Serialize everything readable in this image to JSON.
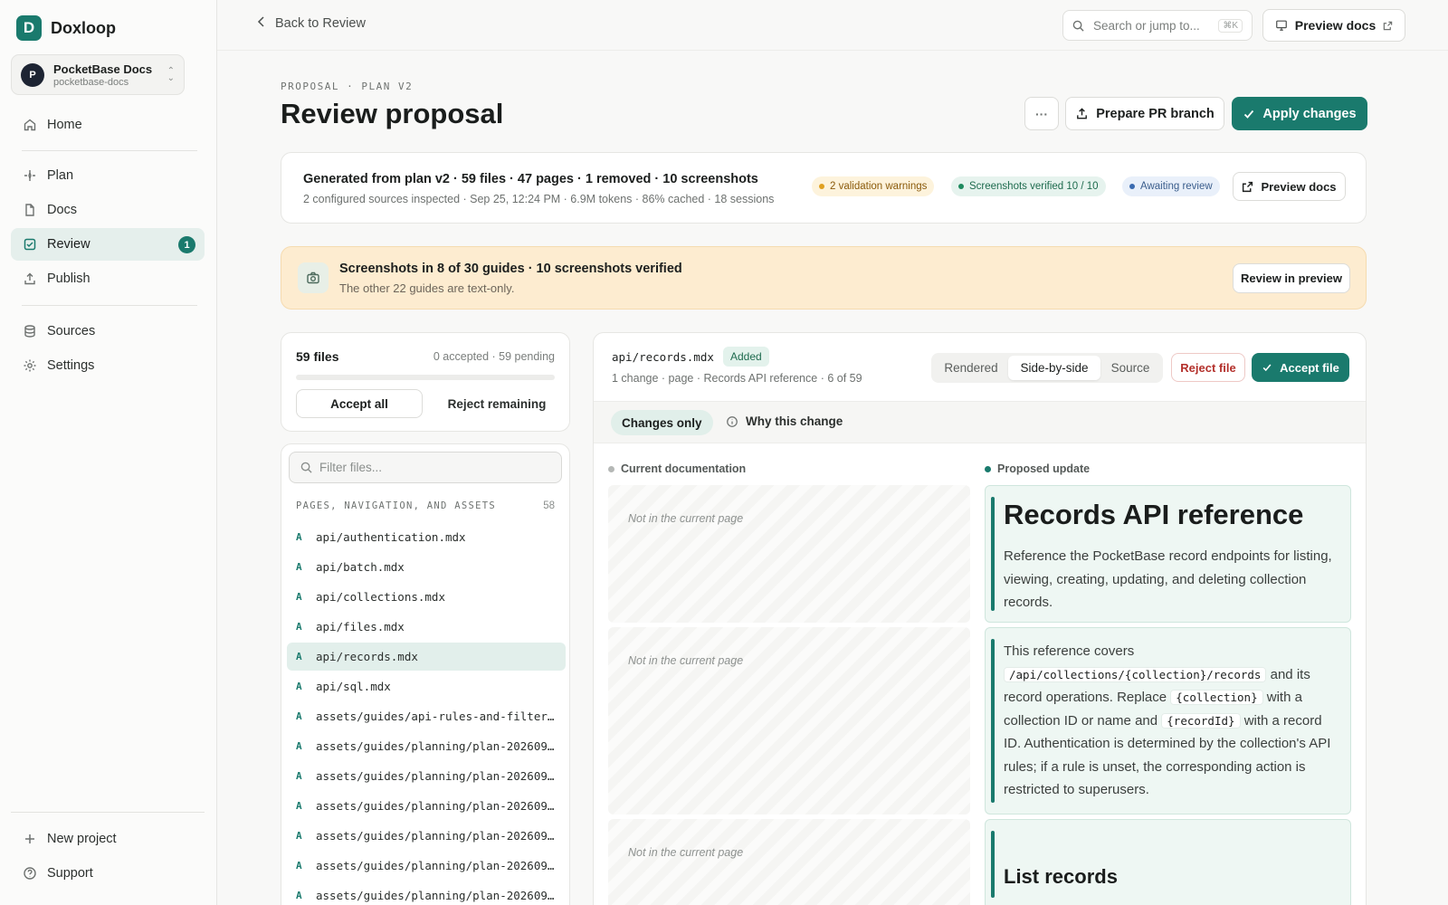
{
  "brand": {
    "logo_letter": "D",
    "name": "Doxloop",
    "accent": "#1a7a6d"
  },
  "project": {
    "avatar": "P",
    "name": "PocketBase Docs",
    "slug": "pocketbase-docs"
  },
  "nav": {
    "home": "Home",
    "plan": "Plan",
    "docs": "Docs",
    "review": "Review",
    "review_badge": "1",
    "publish": "Publish",
    "sources": "Sources",
    "settings": "Settings",
    "new_project": "New project",
    "support": "Support"
  },
  "topbar": {
    "back": "Back to Review",
    "search_placeholder": "Search or jump to...",
    "search_shortcut": "⌘K",
    "preview_docs": "Preview docs"
  },
  "header": {
    "eyebrow": "PROPOSAL · PLAN V2",
    "title": "Review proposal",
    "more": "···",
    "prepare_pr": "Prepare PR branch",
    "apply": "Apply changes"
  },
  "summary": {
    "line1": "Generated from plan v2 · 59 files · 47 pages · 1 removed · 10 screenshots",
    "line2": "2 configured sources inspected · Sep 25, 12:24 PM · 6.9M tokens · 86% cached · 18 sessions",
    "warnings": "2 validation warnings",
    "verified": "Screenshots verified 10 / 10",
    "awaiting": "Awaiting review",
    "preview_docs": "Preview docs"
  },
  "banner": {
    "title": "Screenshots in 8 of 30 guides · 10 screenshots verified",
    "subtitle": "The other 22 guides are text-only.",
    "button": "Review in preview"
  },
  "files": {
    "count": "59 files",
    "status": "0 accepted · 59 pending",
    "accepted_fraction": 0,
    "accept_all": "Accept all",
    "reject_remaining": "Reject remaining",
    "filter_placeholder": "Filter files...",
    "group_label": "PAGES, NAVIGATION, AND ASSETS",
    "group_count": "58",
    "items": [
      {
        "tag": "A",
        "path": "api/authentication.mdx"
      },
      {
        "tag": "A",
        "path": "api/batch.mdx"
      },
      {
        "tag": "A",
        "path": "api/collections.mdx"
      },
      {
        "tag": "A",
        "path": "api/files.mdx"
      },
      {
        "tag": "A",
        "path": "api/records.mdx"
      },
      {
        "tag": "A",
        "path": "api/sql.mdx"
      },
      {
        "tag": "A",
        "path": "assets/guides/api-rules-and-filter…"
      },
      {
        "tag": "A",
        "path": "assets/guides/planning/plan-202609…"
      },
      {
        "tag": "A",
        "path": "assets/guides/planning/plan-202609…"
      },
      {
        "tag": "A",
        "path": "assets/guides/planning/plan-202609…"
      },
      {
        "tag": "A",
        "path": "assets/guides/planning/plan-202609…"
      },
      {
        "tag": "A",
        "path": "assets/guides/planning/plan-202609…"
      },
      {
        "tag": "A",
        "path": "assets/guides/planning/plan-202609…"
      }
    ]
  },
  "detail": {
    "path": "api/records.mdx",
    "badge": "Added",
    "meta": "1 change · page · Records API reference · 6 of 59",
    "view_rendered": "Rendered",
    "view_side": "Side-by-side",
    "view_source": "Source",
    "reject": "Reject file",
    "accept": "Accept file",
    "changes_only": "Changes only",
    "why": "Why this change",
    "col_current": "Current documentation",
    "col_proposed": "Proposed update",
    "not_in_page": "Not in the current page",
    "h1": "Records API reference",
    "intro": "Reference the PocketBase record endpoints for listing, viewing, creating, updating, and deleting collection records.",
    "p2_a": "This reference covers",
    "p2_code1": "/api/collections/{collection}/records",
    "p2_b": "and its record operations. Replace",
    "p2_code2": "{collection}",
    "p2_c": "with a collection ID or name and",
    "p2_code3": "{recordId}",
    "p2_d": "with a record ID. Authentication is determined by the collection's API rules; if a rule is unset, the corresponding action is restricted to superusers.",
    "h2": "List records"
  }
}
